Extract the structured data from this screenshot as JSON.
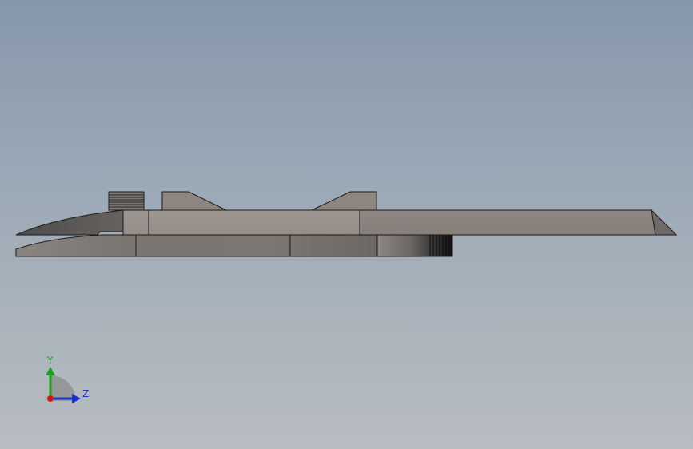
{
  "viewport": {
    "background_top": "#8797ab",
    "background_bottom": "#b7bcc1"
  },
  "model": {
    "part_colors": {
      "body": "#9a928c",
      "body_dark": "#8a827d",
      "jaw": "#5a5857",
      "lower_rail": "#7c7672",
      "knurl": "#3a3a3a",
      "edge": "#1a1a1a"
    }
  },
  "triad": {
    "y_label": "Y",
    "z_label": "Z",
    "y_color": "#19a319",
    "z_color": "#1a33c8",
    "x_color": "#d01818"
  }
}
